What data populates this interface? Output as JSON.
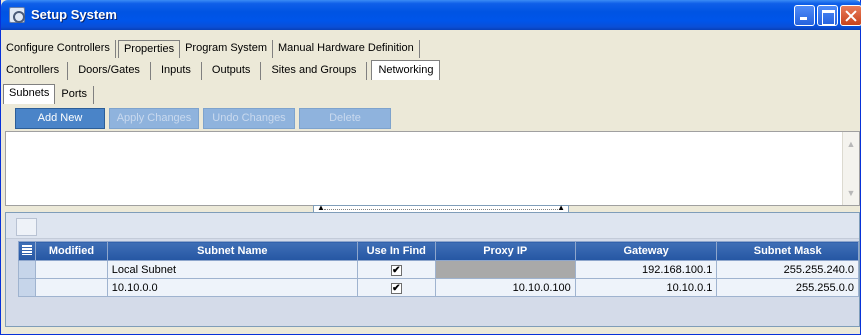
{
  "window": {
    "title": "Setup System"
  },
  "tabs_level1": [
    {
      "label": "Configure Controllers"
    },
    {
      "label": "Properties"
    },
    {
      "label": "Program System"
    },
    {
      "label": "Manual Hardware Definition"
    }
  ],
  "tabs_level2": [
    {
      "label": "Controllers"
    },
    {
      "label": "Doors/Gates"
    },
    {
      "label": "Inputs"
    },
    {
      "label": "Outputs"
    },
    {
      "label": "Sites and Groups"
    },
    {
      "label": "Networking"
    }
  ],
  "tabs_level3": [
    {
      "label": "Subnets"
    },
    {
      "label": "Ports"
    }
  ],
  "toolbar": {
    "add_new": "Add New",
    "apply_changes": "Apply Changes",
    "undo_changes": "Undo Changes",
    "delete": "Delete"
  },
  "grid": {
    "columns": [
      "Modified",
      "Subnet Name",
      "Use In Find",
      "Proxy IP",
      "Gateway",
      "Subnet Mask"
    ],
    "rows": [
      {
        "modified": "",
        "subnet_name": "Local Subnet",
        "use_in_find": "✔",
        "proxy_ip": "",
        "gateway": "192.168.100.1",
        "subnet_mask": "255.255.240.0"
      },
      {
        "modified": "",
        "subnet_name": "10.10.0.0",
        "use_in_find": "✔",
        "proxy_ip": "10.10.0.100",
        "gateway": "10.10.0.1",
        "subnet_mask": "255.255.0.0"
      }
    ]
  },
  "icons": {
    "app": "app-icon",
    "minimize": "minimize-icon",
    "maximize": "maximize-icon",
    "close": "close-icon",
    "grid_menu": "column-chooser-icon",
    "scroll_up": "scroll-up-icon",
    "scroll_down": "scroll-down-icon"
  },
  "colors": {
    "titlebar": "#0054e3",
    "header": "#2556a3",
    "button": "#4a84c8",
    "button_disabled": "#8fb3dd"
  }
}
